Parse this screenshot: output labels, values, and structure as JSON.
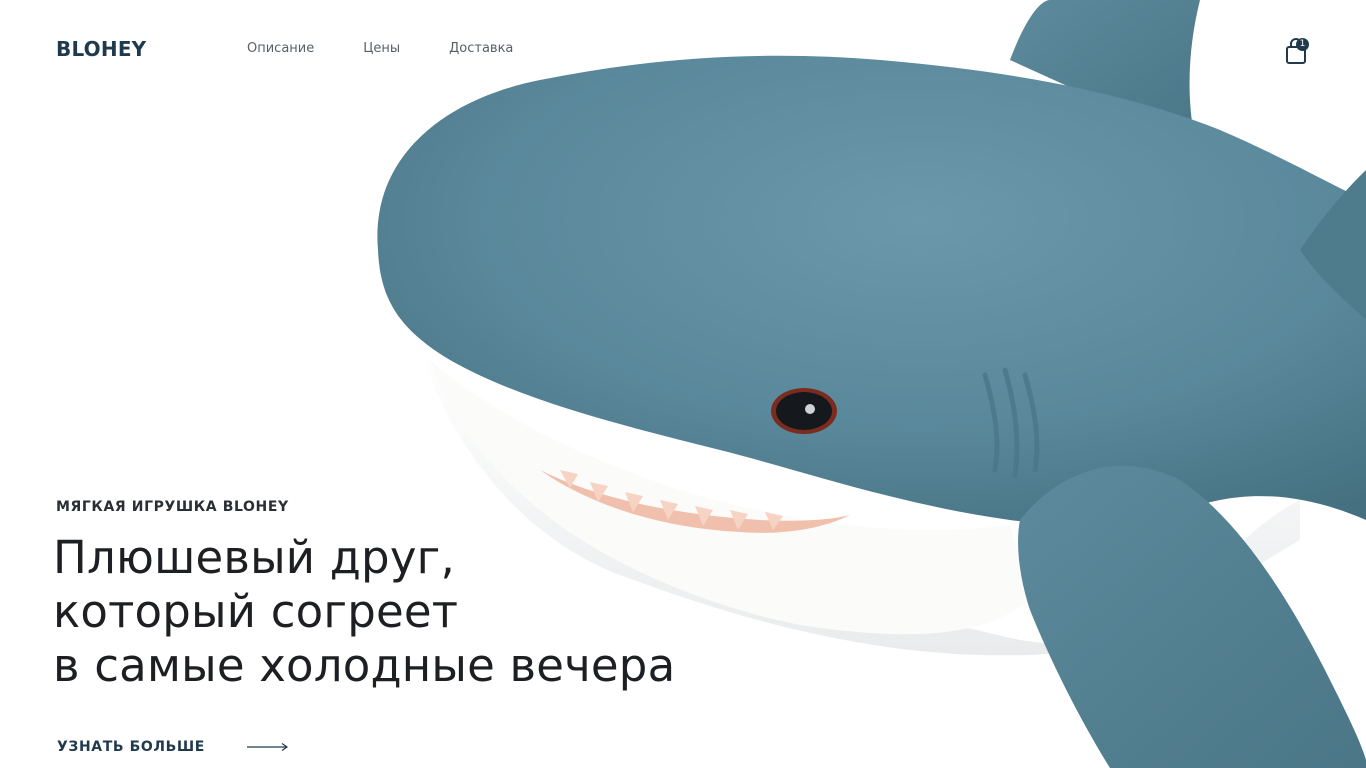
{
  "brand": {
    "logo": "BLOHEY"
  },
  "nav": {
    "items": [
      {
        "label": "Описание"
      },
      {
        "label": "Цены"
      },
      {
        "label": "Доставка"
      }
    ]
  },
  "cart": {
    "count": "1",
    "icon": "shopping-bag-icon"
  },
  "hero": {
    "eyebrow": "МЯГКАЯ ИГРУШКА BLOHEY",
    "headline_lines": [
      "Плюшевый друг,",
      "который согреет",
      "в самые холодные вечера"
    ],
    "cta_label": "УЗНАТЬ БОЛЬШЕ",
    "cta_icon": "arrow-right-icon",
    "image": "shark-plush-toy"
  },
  "colors": {
    "brand": "#1f3a4d",
    "shark_body": "#5b8a9c",
    "shark_belly": "#f4f4f2",
    "teeth": "#f3c5b2"
  }
}
